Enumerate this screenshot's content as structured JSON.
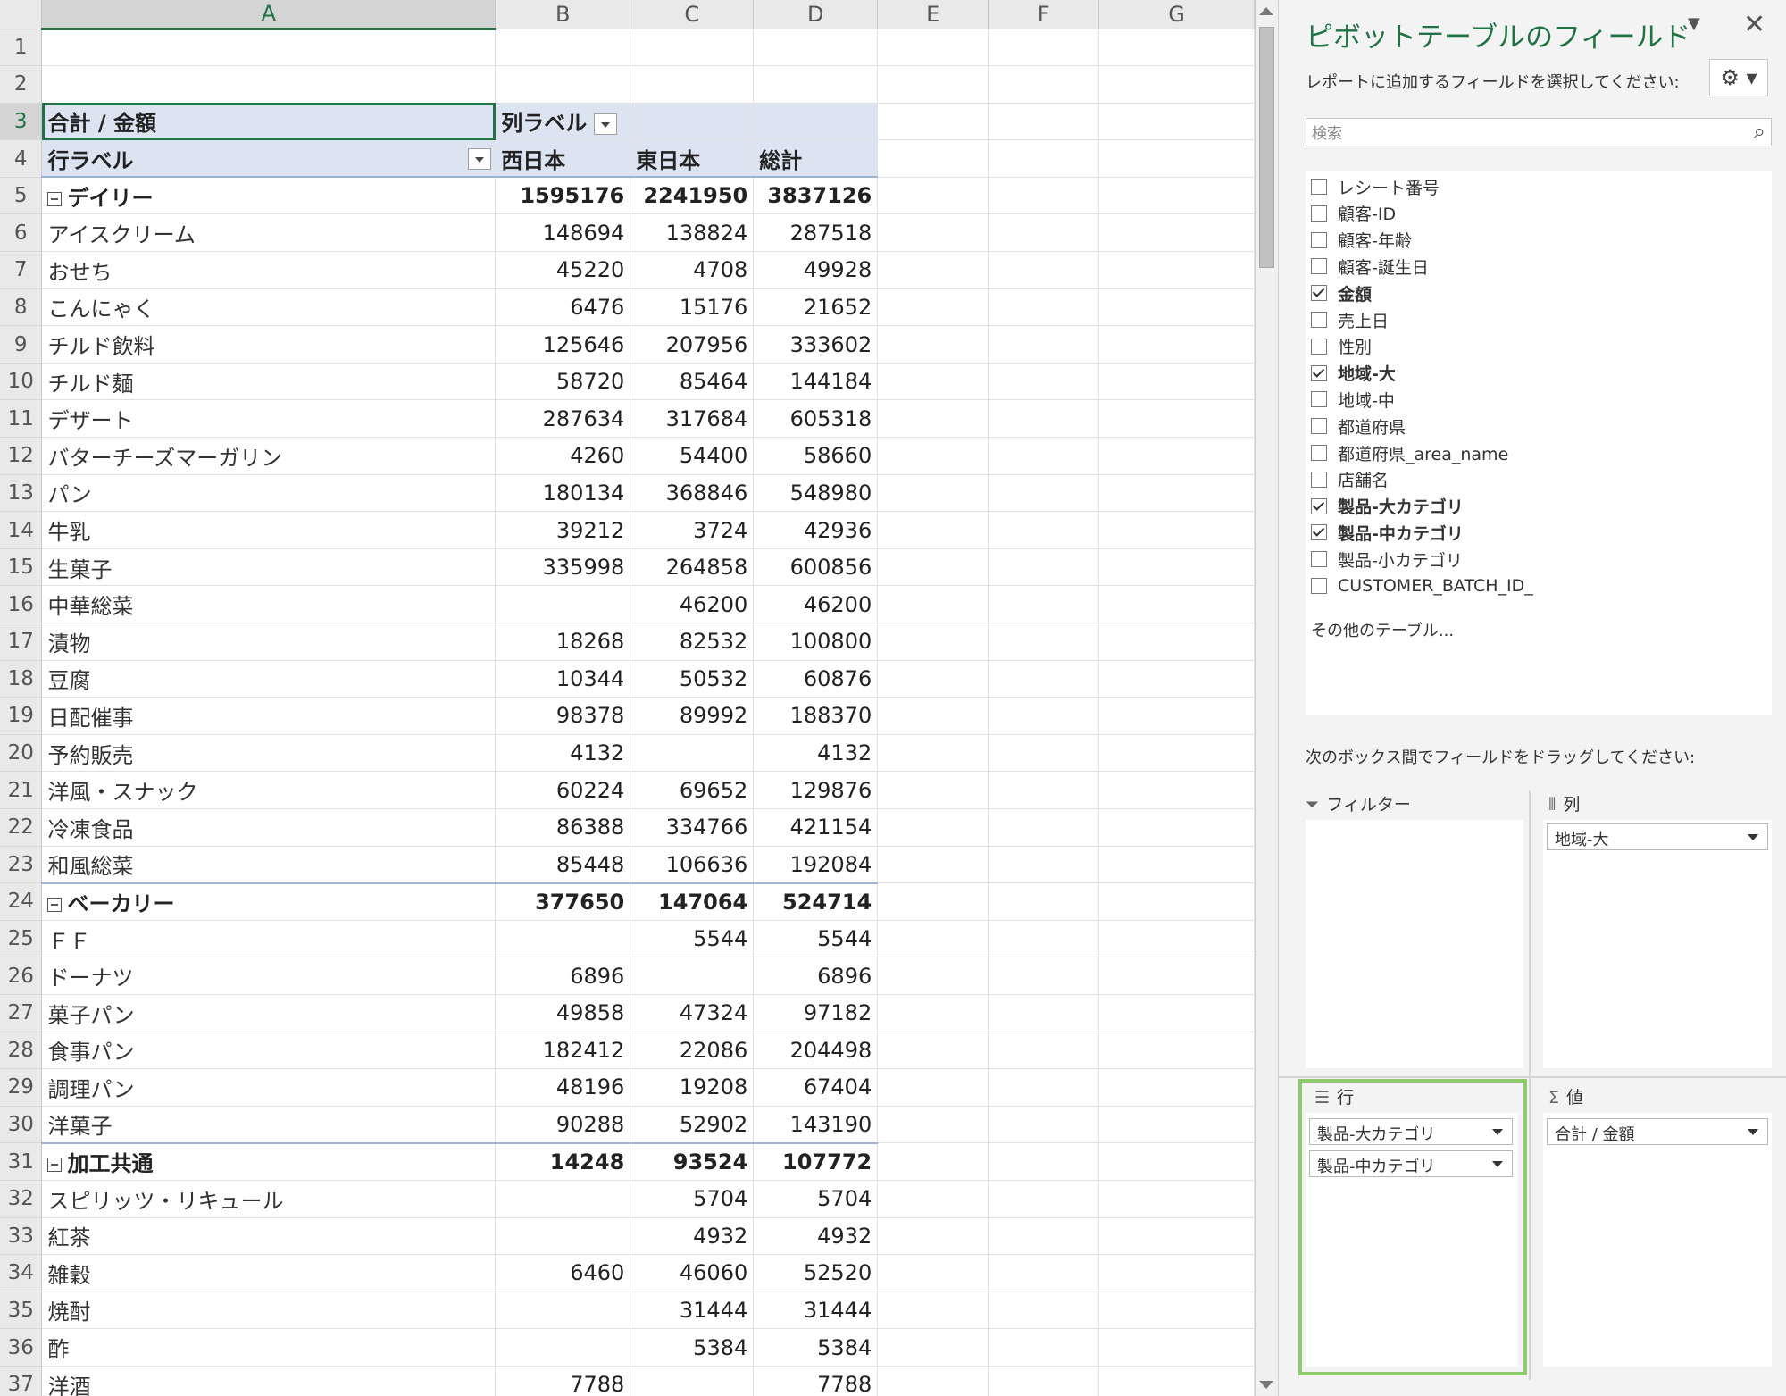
{
  "columns": [
    "A",
    "B",
    "C",
    "D",
    "E",
    "F",
    "G"
  ],
  "pivot": {
    "header_row3": {
      "a": "合計 / 金額",
      "b": "列ラベル"
    },
    "header_row4": {
      "a": "行ラベル",
      "b": "西日本",
      "c": "東日本",
      "d": "総計"
    },
    "rows": [
      {
        "n": "5",
        "type": "group",
        "label": "デイリー",
        "b": "1595176",
        "c": "2241950",
        "d": "3837126"
      },
      {
        "n": "6",
        "type": "item",
        "label": "アイスクリーム",
        "b": "148694",
        "c": "138824",
        "d": "287518"
      },
      {
        "n": "7",
        "type": "item",
        "label": "おせち",
        "b": "45220",
        "c": "4708",
        "d": "49928"
      },
      {
        "n": "8",
        "type": "item",
        "label": "こんにゃく",
        "b": "6476",
        "c": "15176",
        "d": "21652"
      },
      {
        "n": "9",
        "type": "item",
        "label": "チルド飲料",
        "b": "125646",
        "c": "207956",
        "d": "333602"
      },
      {
        "n": "10",
        "type": "item",
        "label": "チルド麺",
        "b": "58720",
        "c": "85464",
        "d": "144184"
      },
      {
        "n": "11",
        "type": "item",
        "label": "デザート",
        "b": "287634",
        "c": "317684",
        "d": "605318"
      },
      {
        "n": "12",
        "type": "item",
        "label": "バターチーズマーガリン",
        "b": "4260",
        "c": "54400",
        "d": "58660"
      },
      {
        "n": "13",
        "type": "item",
        "label": "パン",
        "b": "180134",
        "c": "368846",
        "d": "548980"
      },
      {
        "n": "14",
        "type": "item",
        "label": "牛乳",
        "b": "39212",
        "c": "3724",
        "d": "42936"
      },
      {
        "n": "15",
        "type": "item",
        "label": "生菓子",
        "b": "335998",
        "c": "264858",
        "d": "600856"
      },
      {
        "n": "16",
        "type": "item",
        "label": "中華総菜",
        "b": "",
        "c": "46200",
        "d": "46200"
      },
      {
        "n": "17",
        "type": "item",
        "label": "漬物",
        "b": "18268",
        "c": "82532",
        "d": "100800"
      },
      {
        "n": "18",
        "type": "item",
        "label": "豆腐",
        "b": "10344",
        "c": "50532",
        "d": "60876"
      },
      {
        "n": "19",
        "type": "item",
        "label": "日配催事",
        "b": "98378",
        "c": "89992",
        "d": "188370"
      },
      {
        "n": "20",
        "type": "item",
        "label": "予約販売",
        "b": "4132",
        "c": "",
        "d": "4132"
      },
      {
        "n": "21",
        "type": "item",
        "label": "洋風・スナック",
        "b": "60224",
        "c": "69652",
        "d": "129876"
      },
      {
        "n": "22",
        "type": "item",
        "label": "冷凍食品",
        "b": "86388",
        "c": "334766",
        "d": "421154"
      },
      {
        "n": "23",
        "type": "item",
        "label": "和風総菜",
        "b": "85448",
        "c": "106636",
        "d": "192084"
      },
      {
        "n": "24",
        "type": "group",
        "label": "ベーカリー",
        "b": "377650",
        "c": "147064",
        "d": "524714"
      },
      {
        "n": "25",
        "type": "item",
        "label": "ＦＦ",
        "b": "",
        "c": "5544",
        "d": "5544"
      },
      {
        "n": "26",
        "type": "item",
        "label": "ドーナツ",
        "b": "6896",
        "c": "",
        "d": "6896"
      },
      {
        "n": "27",
        "type": "item",
        "label": "菓子パン",
        "b": "49858",
        "c": "47324",
        "d": "97182"
      },
      {
        "n": "28",
        "type": "item",
        "label": "食事パン",
        "b": "182412",
        "c": "22086",
        "d": "204498"
      },
      {
        "n": "29",
        "type": "item",
        "label": "調理パン",
        "b": "48196",
        "c": "19208",
        "d": "67404"
      },
      {
        "n": "30",
        "type": "item",
        "label": "洋菓子",
        "b": "90288",
        "c": "52902",
        "d": "143190"
      },
      {
        "n": "31",
        "type": "group",
        "label": "加工共通",
        "b": "14248",
        "c": "93524",
        "d": "107772"
      },
      {
        "n": "32",
        "type": "item",
        "label": "スピリッツ・リキュール",
        "b": "",
        "c": "5704",
        "d": "5704"
      },
      {
        "n": "33",
        "type": "item",
        "label": "紅茶",
        "b": "",
        "c": "4932",
        "d": "4932"
      },
      {
        "n": "34",
        "type": "item",
        "label": "雑穀",
        "b": "6460",
        "c": "46060",
        "d": "52520"
      },
      {
        "n": "35",
        "type": "item",
        "label": "焼酎",
        "b": "",
        "c": "31444",
        "d": "31444"
      },
      {
        "n": "36",
        "type": "item",
        "label": "酢",
        "b": "",
        "c": "5384",
        "d": "5384"
      },
      {
        "n": "37",
        "type": "item",
        "label": "洋酒",
        "b": "7788",
        "c": "",
        "d": "7788"
      }
    ]
  },
  "pane": {
    "title": "ピボットテーブルのフィールド",
    "subtitle": "レポートに追加するフィールドを選択してください:",
    "search_placeholder": "検索",
    "fields": [
      {
        "label": "レシート番号",
        "checked": false
      },
      {
        "label": "顧客-ID",
        "checked": false
      },
      {
        "label": "顧客-年齢",
        "checked": false
      },
      {
        "label": "顧客-誕生日",
        "checked": false
      },
      {
        "label": "金額",
        "checked": true
      },
      {
        "label": "売上日",
        "checked": false
      },
      {
        "label": "性別",
        "checked": false
      },
      {
        "label": "地域-大",
        "checked": true
      },
      {
        "label": "地域-中",
        "checked": false
      },
      {
        "label": "都道府県",
        "checked": false
      },
      {
        "label": "都道府県_area_name",
        "checked": false
      },
      {
        "label": "店舗名",
        "checked": false
      },
      {
        "label": "製品-大カテゴリ",
        "checked": true
      },
      {
        "label": "製品-中カテゴリ",
        "checked": true
      },
      {
        "label": "製品-小カテゴリ",
        "checked": false
      },
      {
        "label": "CUSTOMER_BATCH_ID_",
        "checked": false
      }
    ],
    "more_tables": "その他のテーブル...",
    "drag_note": "次のボックス間でフィールドをドラッグしてください:",
    "areas": {
      "filter": {
        "label": "フィルター"
      },
      "columns": {
        "label": "列",
        "chips": [
          "地域-大"
        ]
      },
      "rows": {
        "label": "行",
        "chips": [
          "製品-大カテゴリ",
          "製品-中カテゴリ"
        ]
      },
      "values": {
        "label": "値",
        "chips": [
          "合計 / 金額"
        ]
      }
    },
    "highlight_color": "#8fca6e",
    "title_color": "#217346"
  }
}
